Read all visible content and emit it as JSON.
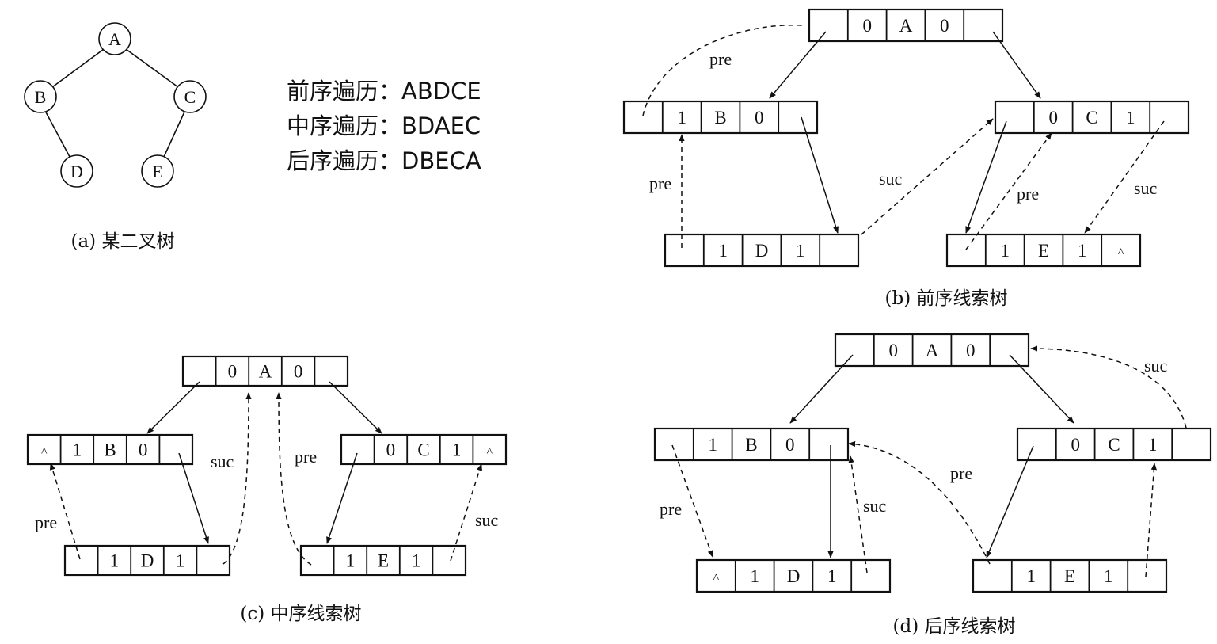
{
  "tree": {
    "nodes": [
      "A",
      "B",
      "C",
      "D",
      "E"
    ],
    "caption": "(a) 某二叉树"
  },
  "traversals": [
    {
      "label": "前序遍历：",
      "value": "ABDCE"
    },
    {
      "label": "中序遍历：",
      "value": "BDAEC"
    },
    {
      "label": "后序遍历：",
      "value": "DBECA"
    }
  ],
  "diagrams": {
    "preorder": {
      "caption": "(b) 前序线索树",
      "labels": [
        "pre",
        "pre",
        "suc",
        "pre",
        "suc"
      ],
      "rows": {
        "A": [
          "",
          "0",
          "A",
          "0",
          ""
        ],
        "B": [
          "",
          "1",
          "B",
          "0",
          ""
        ],
        "C": [
          "",
          "0",
          "C",
          "1",
          ""
        ],
        "D": [
          "",
          "1",
          "D",
          "1",
          ""
        ],
        "E": [
          "",
          "1",
          "E",
          "1",
          "^"
        ]
      }
    },
    "inorder": {
      "caption": "(c) 中序线索树",
      "labels": [
        "suc",
        "pre",
        "pre",
        "suc"
      ],
      "rows": {
        "A": [
          "",
          "0",
          "A",
          "0",
          ""
        ],
        "B": [
          "^",
          "1",
          "B",
          "0",
          ""
        ],
        "C": [
          "",
          "0",
          "C",
          "1",
          "^"
        ],
        "D": [
          "",
          "1",
          "D",
          "1",
          ""
        ],
        "E": [
          "",
          "1",
          "E",
          "1",
          ""
        ]
      }
    },
    "postorder": {
      "caption": "(d) 后序线索树",
      "labels": [
        "suc",
        "pre",
        "pre",
        "suc"
      ],
      "rows": {
        "A": [
          "",
          "0",
          "A",
          "0",
          ""
        ],
        "B": [
          "",
          "1",
          "B",
          "0",
          ""
        ],
        "C": [
          "",
          "0",
          "C",
          "1",
          ""
        ],
        "D": [
          "^",
          "1",
          "D",
          "1",
          ""
        ],
        "E": [
          "",
          "1",
          "E",
          "1",
          ""
        ]
      }
    }
  }
}
